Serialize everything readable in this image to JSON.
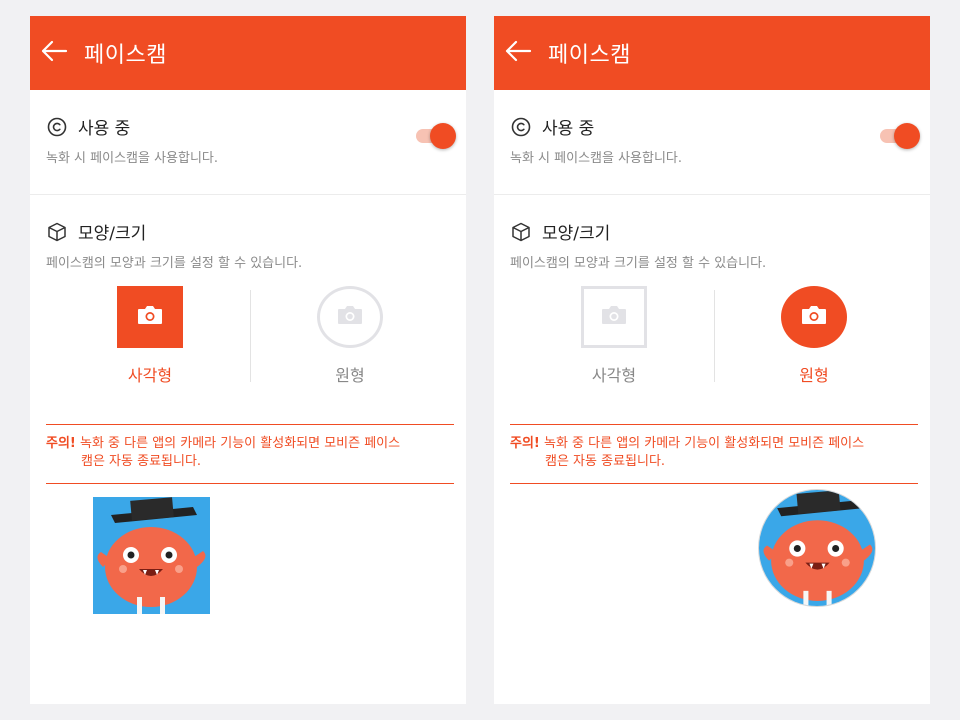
{
  "panels": [
    {
      "appbar": {
        "title": "페이스캠"
      },
      "usage": {
        "title": "사용 중",
        "description": "녹화 시 페이스캠을 사용합니다.",
        "toggle_on": true
      },
      "shape": {
        "title": "모양/크기",
        "description": "페이스캠의 모양과 크기를 설정 할 수 있습니다.",
        "options": [
          {
            "label": "사각형",
            "selected": true
          },
          {
            "label": "원형",
            "selected": false
          }
        ]
      },
      "warning": {
        "label": "주의!",
        "line1": "녹화 중 다른 앱의 카메라 기능이 활성화되면 모비즌 페이스",
        "line2": "캠은 자동 종료됩니다."
      },
      "preview": {
        "shape": "square"
      }
    },
    {
      "appbar": {
        "title": "페이스캠"
      },
      "usage": {
        "title": "사용 중",
        "description": "녹화 시 페이스캠을 사용합니다.",
        "toggle_on": true
      },
      "shape": {
        "title": "모양/크기",
        "description": "페이스캠의 모양과 크기를 설정 할 수 있습니다.",
        "options": [
          {
            "label": "사각형",
            "selected": false
          },
          {
            "label": "원형",
            "selected": true
          }
        ]
      },
      "warning": {
        "label": "주의!",
        "line1": "녹화 중 다른 앱의 카메라 기능이 활성화되면 모비즌 페이스",
        "line2": "캠은 자동 종료됩니다."
      },
      "preview": {
        "shape": "circle"
      }
    }
  ],
  "icons": {
    "back": "arrow-left-icon",
    "usage": "copyright-icon",
    "shape": "cube-icon",
    "camera": "camera-icon"
  },
  "colors": {
    "accent": "#f04c23",
    "toggle_track": "#f7c2b3",
    "inactive_border": "#e2e2e6",
    "preview_bg": "#3aa7e8"
  }
}
